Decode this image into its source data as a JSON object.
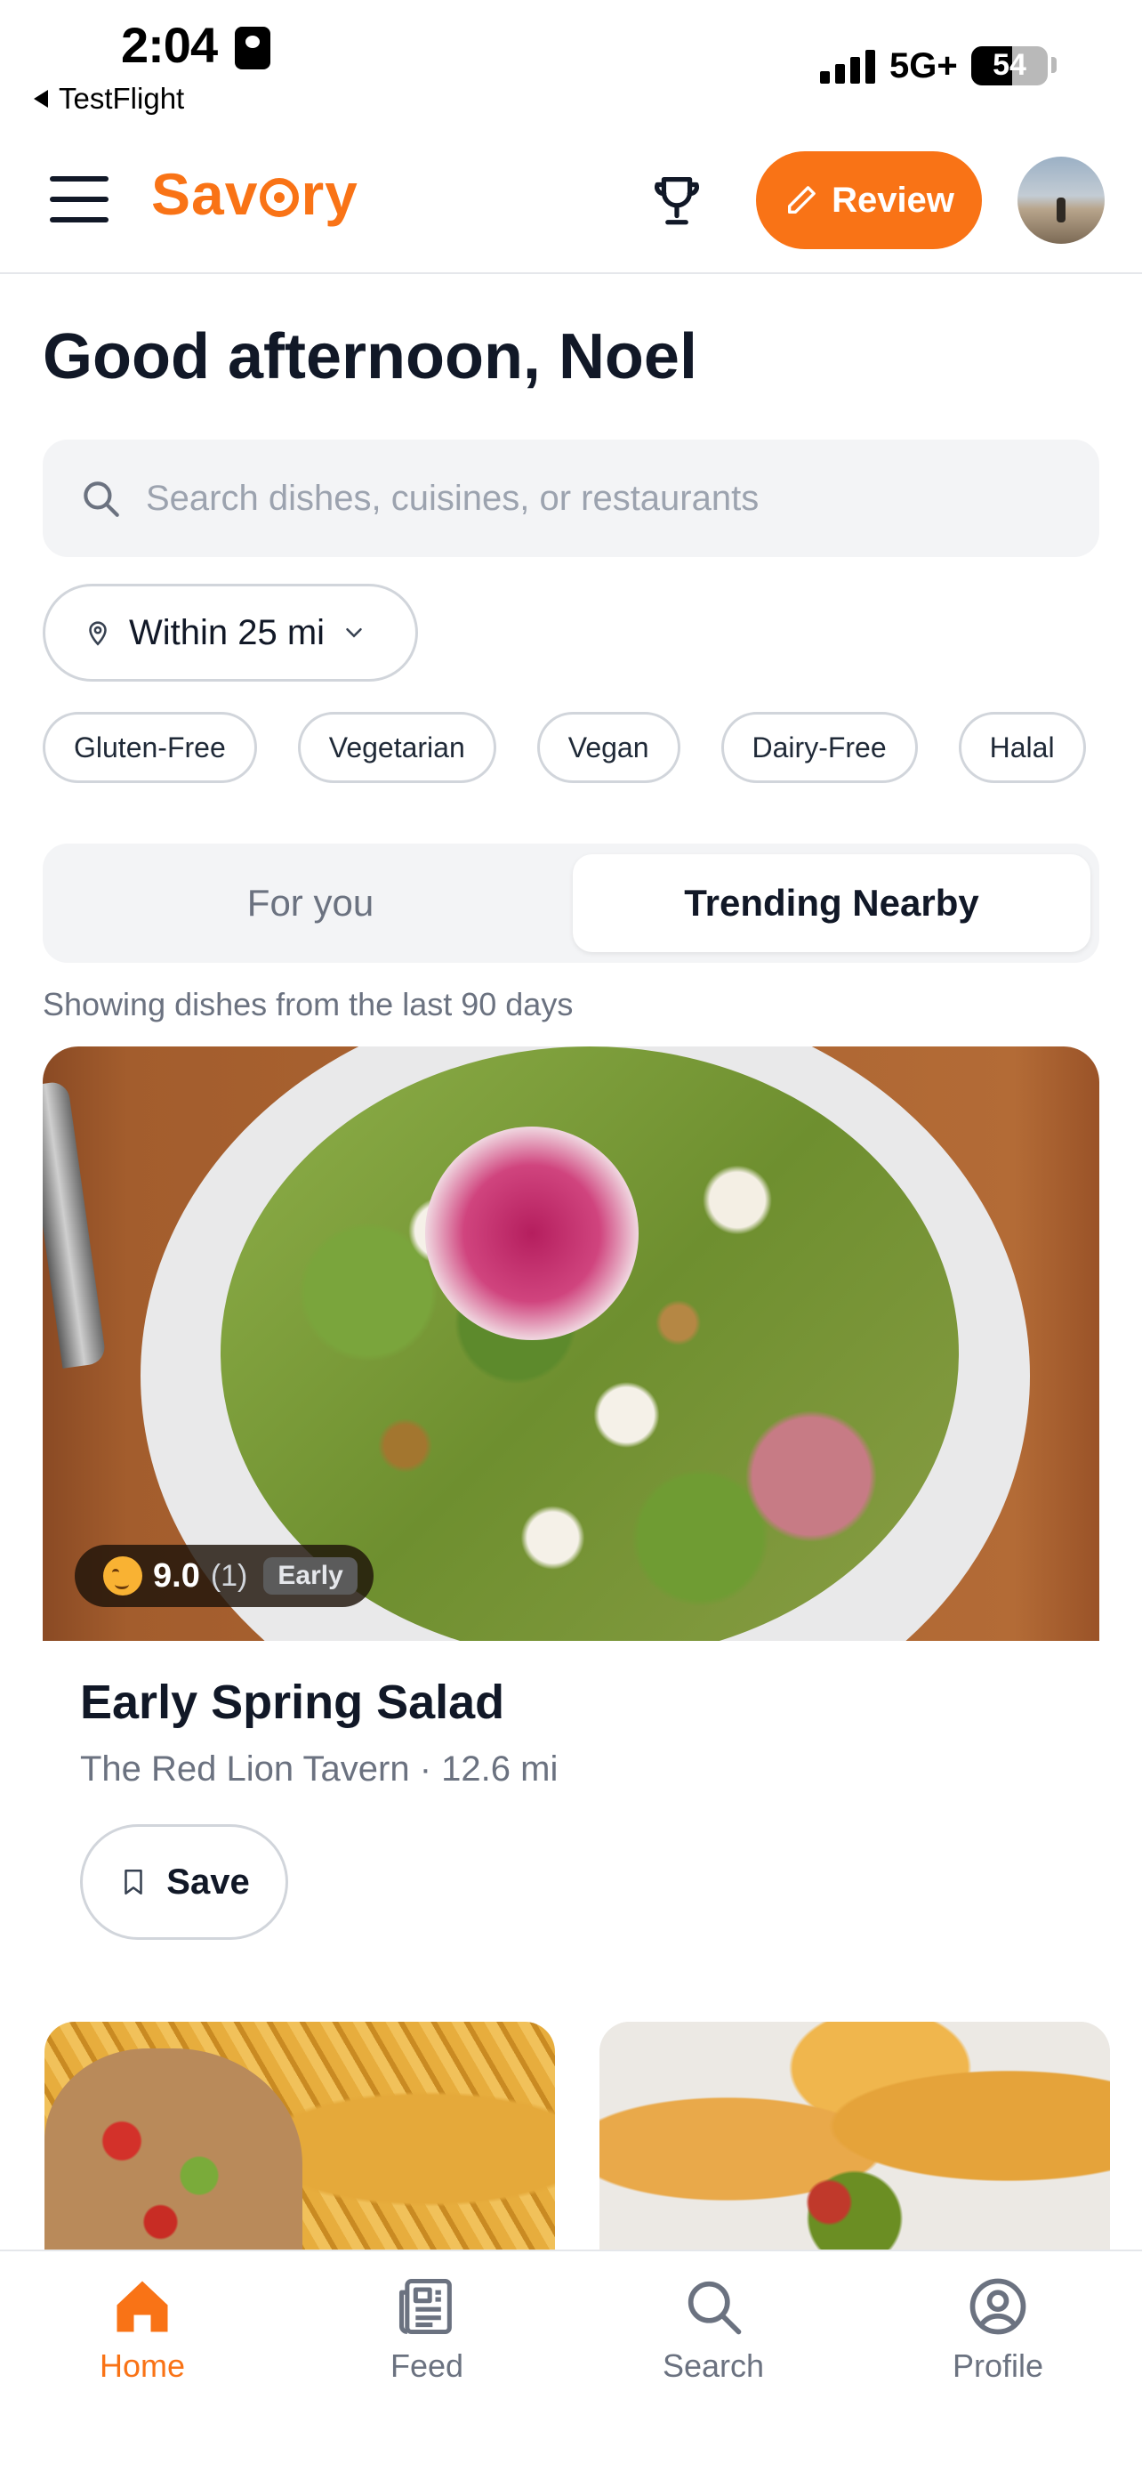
{
  "status_bar": {
    "time": "2:04",
    "back_label": "TestFlight",
    "network": "5G+",
    "battery": "54",
    "battery_level": 0.54
  },
  "header": {
    "logo_text_before": "Sav",
    "logo_text_after": "ry",
    "review_label": "Review",
    "icons": [
      "menu-icon",
      "trophy-icon",
      "pencil-icon",
      "avatar"
    ]
  },
  "greeting": "Good afternoon, Noel",
  "search": {
    "placeholder": "Search dishes, cuisines, or restaurants"
  },
  "distance_filter": {
    "label": "Within 25 mi"
  },
  "diet_chips": [
    "Gluten-Free",
    "Vegetarian",
    "Vegan",
    "Dairy-Free",
    "Halal"
  ],
  "tabs": {
    "for_you": "For you",
    "trending": "Trending Nearby",
    "active": "Trending Nearby"
  },
  "hint": "Showing dishes from the last 90 days",
  "featured": {
    "score": "9.0",
    "count": "(1)",
    "badge": "Early",
    "title": "Early Spring Salad",
    "subtitle": "The Red Lion Tavern · 12.6 mi",
    "save_label": "Save"
  },
  "bottom_nav": {
    "home": "Home",
    "feed": "Feed",
    "search": "Search",
    "profile": "Profile",
    "active": "Home"
  },
  "colors": {
    "accent": "#f97316",
    "text": "#111827",
    "muted": "#6b7280"
  }
}
